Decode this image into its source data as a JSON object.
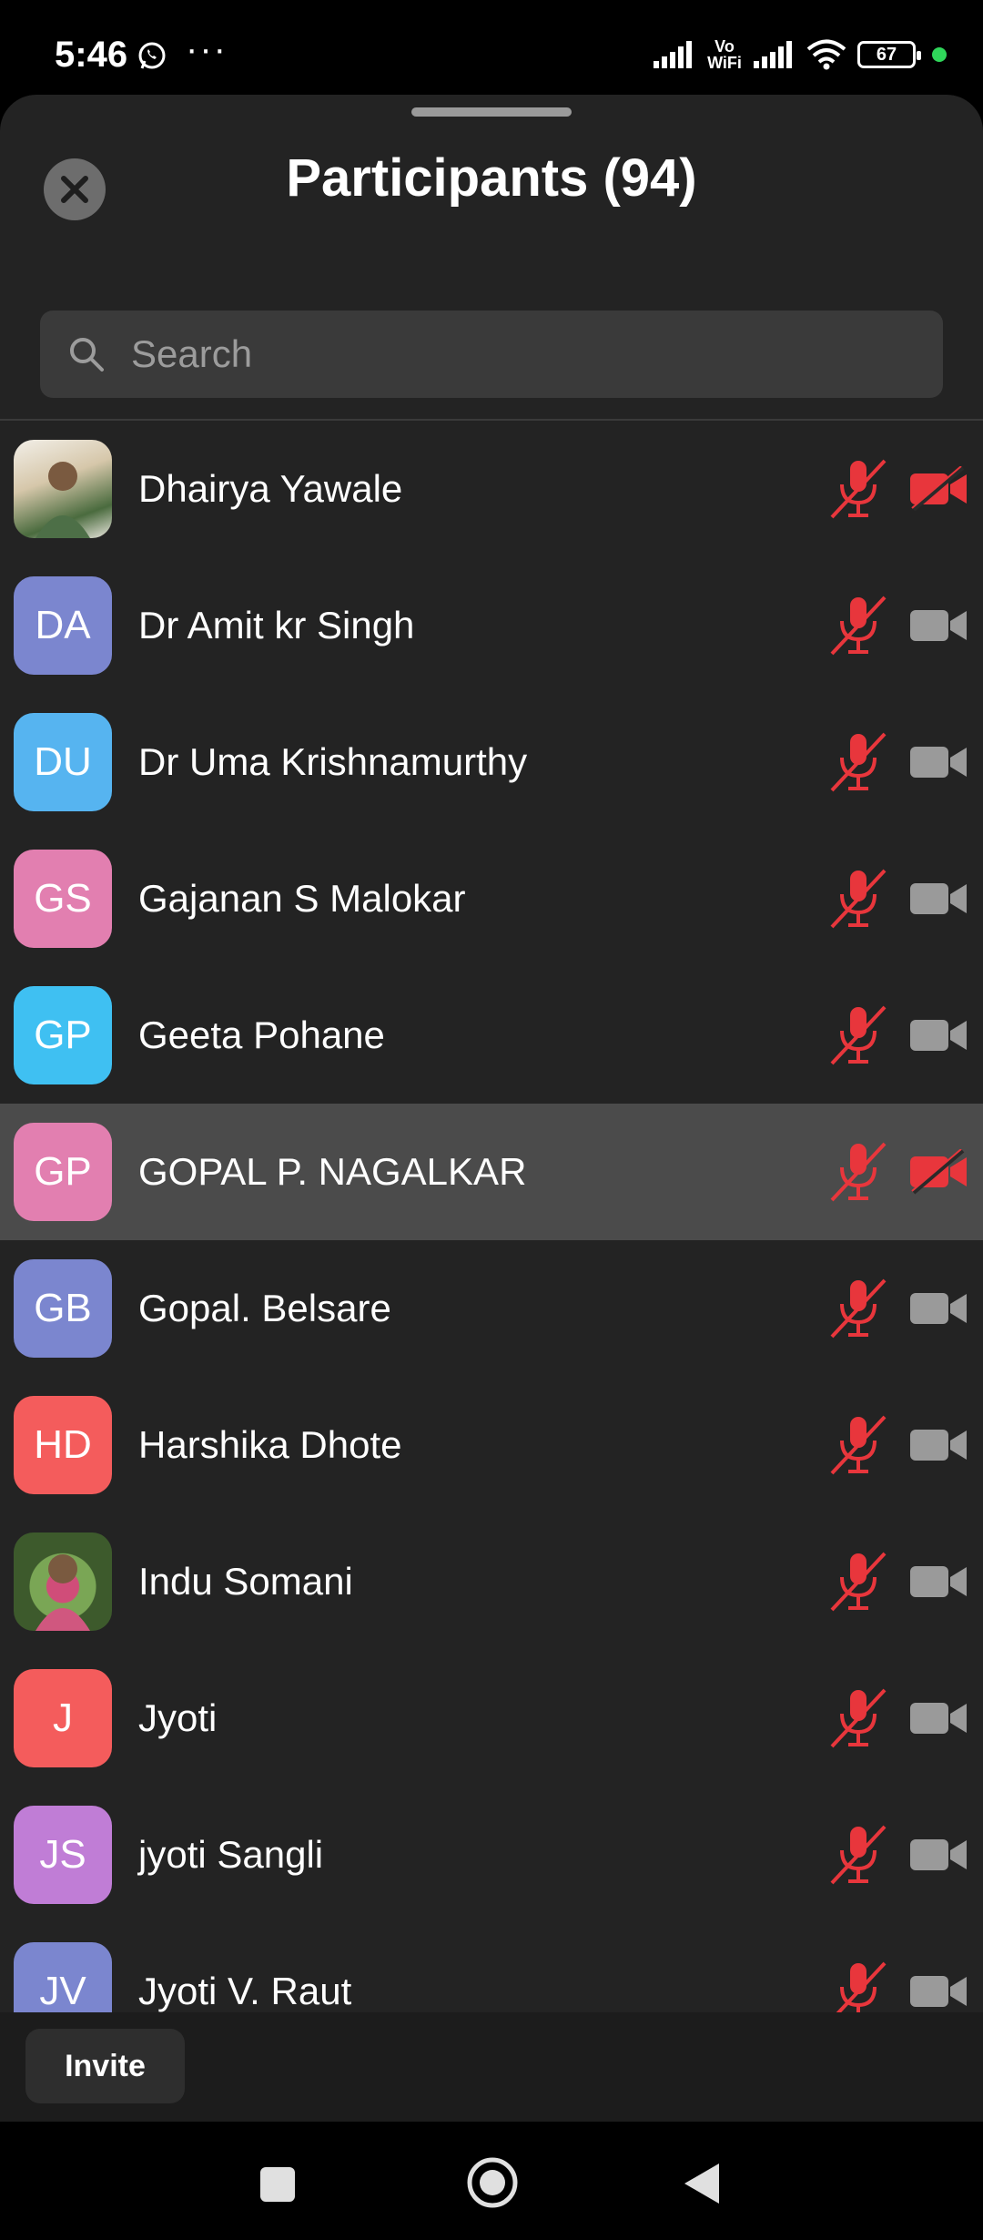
{
  "status_bar": {
    "time": "5:46",
    "overflow": "···",
    "vowifi": "Vo\nWiFi",
    "battery": "67",
    "icons": [
      "whatsapp-icon",
      "signal-icon",
      "vowifi-icon",
      "signal-icon",
      "wifi-icon",
      "battery-icon"
    ]
  },
  "header": {
    "title": "Participants (94)",
    "close_icon": "close-icon"
  },
  "search": {
    "placeholder": "Search",
    "value": ""
  },
  "participants": [
    {
      "name": "Dhairya Yawale",
      "initials": "",
      "photo": true,
      "avatar_color": "#c9b48e",
      "mic_muted": true,
      "video_off_red": true
    },
    {
      "name": "Dr Amit kr Singh",
      "initials": "DA",
      "photo": false,
      "avatar_color": "#7b86cf",
      "mic_muted": true,
      "video_off_red": false
    },
    {
      "name": "Dr Uma Krishnamurthy",
      "initials": "DU",
      "photo": false,
      "avatar_color": "#56b4f0",
      "mic_muted": true,
      "video_off_red": false
    },
    {
      "name": "Gajanan S Malokar",
      "initials": "GS",
      "photo": false,
      "avatar_color": "#e27fb0",
      "mic_muted": true,
      "video_off_red": false
    },
    {
      "name": "Geeta Pohane",
      "initials": "GP",
      "photo": false,
      "avatar_color": "#3fc0f2",
      "mic_muted": true,
      "video_off_red": false
    },
    {
      "name": "GOPAL P. NAGALKAR",
      "initials": "GP",
      "photo": false,
      "avatar_color": "#e27fb0",
      "mic_muted": true,
      "video_off_red": true,
      "selected": true
    },
    {
      "name": "Gopal. Belsare",
      "initials": "GB",
      "photo": false,
      "avatar_color": "#7b86cf",
      "mic_muted": true,
      "video_off_red": false
    },
    {
      "name": "Harshika Dhote",
      "initials": "HD",
      "photo": false,
      "avatar_color": "#f45c5c",
      "mic_muted": true,
      "video_off_red": false
    },
    {
      "name": "Indu Somani",
      "initials": "",
      "photo": true,
      "avatar_color": "#4f6b3a",
      "mic_muted": true,
      "video_off_red": false
    },
    {
      "name": "Jyoti",
      "initials": "J",
      "photo": false,
      "avatar_color": "#f45c5c",
      "mic_muted": true,
      "video_off_red": false
    },
    {
      "name": "jyoti Sangli",
      "initials": "JS",
      "photo": false,
      "avatar_color": "#c07dd6",
      "mic_muted": true,
      "video_off_red": false
    },
    {
      "name": "Jyoti V. Raut",
      "initials": "JV",
      "photo": false,
      "avatar_color": "#7b86cf",
      "mic_muted": true,
      "video_off_red": false
    }
  ],
  "footer": {
    "invite_label": "Invite"
  },
  "colors": {
    "sheet_bg": "#232323",
    "muted_red": "#e8363c",
    "camera_gray": "#9a9a9a",
    "selected_row": "#4b4b4b"
  },
  "nav_icons": [
    "recents-square-icon",
    "home-circle-icon",
    "back-triangle-icon"
  ]
}
